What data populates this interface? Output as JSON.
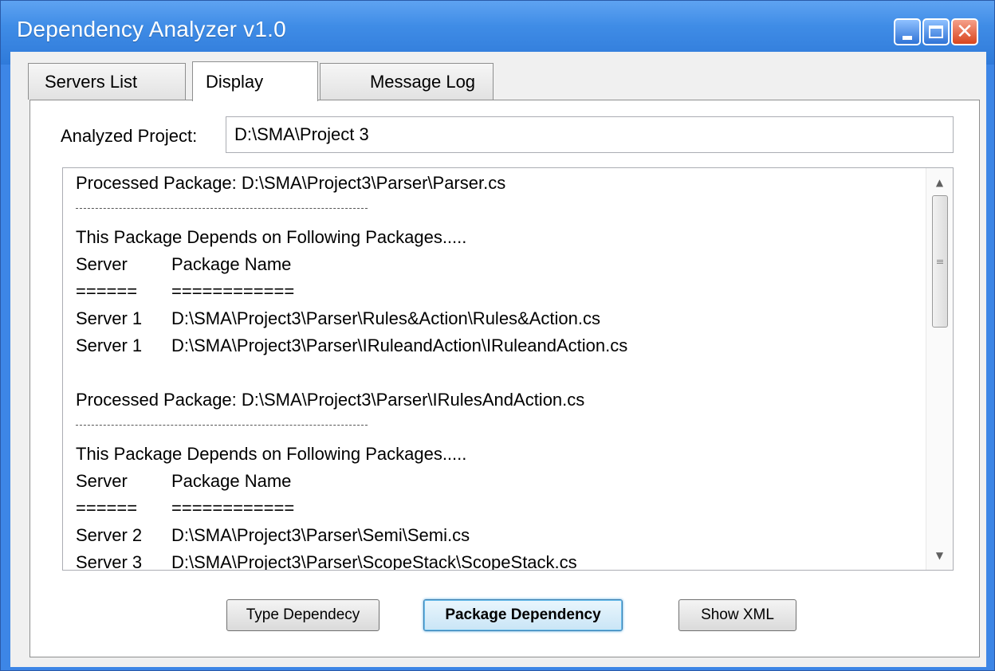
{
  "window": {
    "title": "Dependency Analyzer v1.0",
    "controls": {
      "minimize": "minimize-icon",
      "maximize": "maximize-icon",
      "close": "close-icon"
    }
  },
  "tabs": [
    {
      "label": "Servers List"
    },
    {
      "label": "Display",
      "selected": true
    },
    {
      "label": "Message Log"
    }
  ],
  "project": {
    "label": "Analyzed Project:",
    "value": "D:\\SMA\\Project 3"
  },
  "output": {
    "block1": {
      "processed": "Processed Package: D:\\SMA\\Project3\\Parser\\Parser.cs",
      "depends": "This Package Depends on Following Packages.....",
      "col_server": "Server",
      "col_package": "Package Name",
      "ul_server": "======",
      "ul_package": "============",
      "rows": [
        {
          "server": "Server 1",
          "package": "D:\\SMA\\Project3\\Parser\\Rules&Action\\Rules&Action.cs"
        },
        {
          "server": "Server 1",
          "package": "D:\\SMA\\Project3\\Parser\\IRuleandAction\\IRuleandAction.cs"
        }
      ]
    },
    "block2": {
      "processed": "Processed Package: D:\\SMA\\Project3\\Parser\\IRulesAndAction.cs",
      "depends": "This Package Depends on Following Packages.....",
      "col_server": "Server",
      "col_package": "Package Name",
      "ul_server": "======",
      "ul_package": "============",
      "rows": [
        {
          "server": "Server 2",
          "package": "D:\\SMA\\Project3\\Parser\\Semi\\Semi.cs"
        },
        {
          "server": "Server 3",
          "package": "D:\\SMA\\Project3\\Parser\\ScopeStack\\ScopeStack.cs"
        }
      ]
    }
  },
  "buttons": {
    "type_dependency": "Type Dependecy",
    "package_dependency": "Package Dependency",
    "show_xml": "Show XML"
  },
  "colors": {
    "titlebar": "#3f8ce6",
    "client": "#f0f0f0",
    "focus_button_border": "#3c7fb1"
  }
}
